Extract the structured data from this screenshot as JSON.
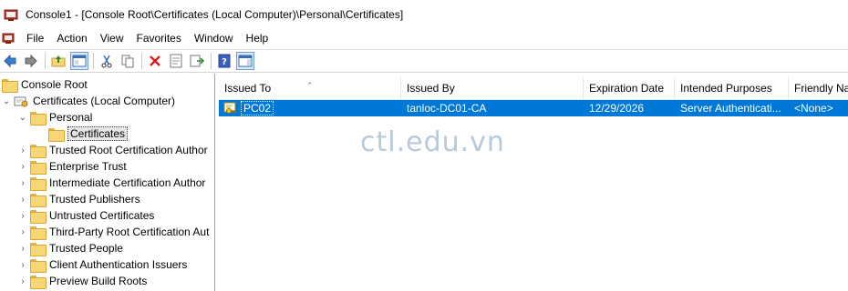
{
  "window": {
    "title": "Console1 - [Console Root\\Certificates (Local Computer)\\Personal\\Certificates]"
  },
  "menu": [
    "File",
    "Action",
    "View",
    "Favorites",
    "Window",
    "Help"
  ],
  "toolbar": {
    "buttons": [
      "back-icon",
      "forward-icon",
      "up-folder-icon",
      "show-hide-tree-icon",
      "cut-icon",
      "copy-icon",
      "delete-icon",
      "properties-icon",
      "export-list-icon",
      "help-icon",
      "action-pane-icon"
    ]
  },
  "tree": {
    "root": "Console Root",
    "store": "Certificates (Local Computer)",
    "personal": "Personal",
    "selected": "Certificates",
    "folders": [
      "Trusted Root Certification Author",
      "Enterprise Trust",
      "Intermediate Certification Author",
      "Trusted Publishers",
      "Untrusted Certificates",
      "Third-Party Root Certification Aut",
      "Trusted People",
      "Client Authentication Issuers",
      "Preview Build Roots"
    ]
  },
  "list": {
    "columns": [
      "Issued To",
      "Issued By",
      "Expiration Date",
      "Intended Purposes",
      "Friendly Na"
    ],
    "rows": [
      {
        "issued_to": "PC02",
        "issued_by": "tanloc-DC01-CA",
        "expiration": "12/29/2026",
        "purposes": "Server Authenticati...",
        "friendly": "<None>"
      }
    ]
  },
  "watermark": "ctl.edu.vn",
  "colors": {
    "selection": "#0078d7",
    "folder": "#f8d676"
  }
}
